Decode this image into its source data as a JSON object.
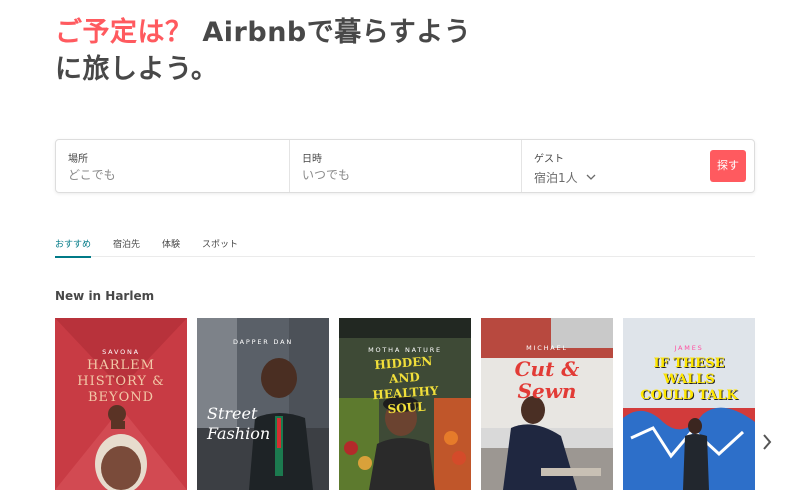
{
  "hero": {
    "accent_text": "ご予定は？",
    "rest_text": " Airbnbで暮らすように旅しよう。"
  },
  "search": {
    "where_label": "場所",
    "where_placeholder": "どこでも",
    "when_label": "日時",
    "when_placeholder": "いつでも",
    "guests_label": "ゲスト",
    "guests_value": "宿泊1人",
    "button_label": "探す"
  },
  "tabs": [
    {
      "label": "おすすめ",
      "active": true
    },
    {
      "label": "宿泊先",
      "active": false
    },
    {
      "label": "体験",
      "active": false
    },
    {
      "label": "スポット",
      "active": false
    }
  ],
  "section_title": "New in Harlem",
  "cards": [
    {
      "caption": "SAVONA",
      "title": "HARLEM HISTORY & BEYOND"
    },
    {
      "caption": "DAPPER DAN",
      "title": "Street Fashion"
    },
    {
      "caption": "MOTHA NATURE",
      "title": "HIDDEN AND HEALTHY SOUL"
    },
    {
      "caption": "MICHAEL",
      "title": "Cut & Sewn"
    },
    {
      "caption": "JAMES",
      "title": "IF THESE WALLS COULD TALK"
    }
  ],
  "colors": {
    "brand": "#FF5A5F",
    "tab_active": "#007A87"
  },
  "icons": {
    "guests_dropdown": "chevron-down-icon",
    "carousel_next": "chevron-right-icon"
  }
}
